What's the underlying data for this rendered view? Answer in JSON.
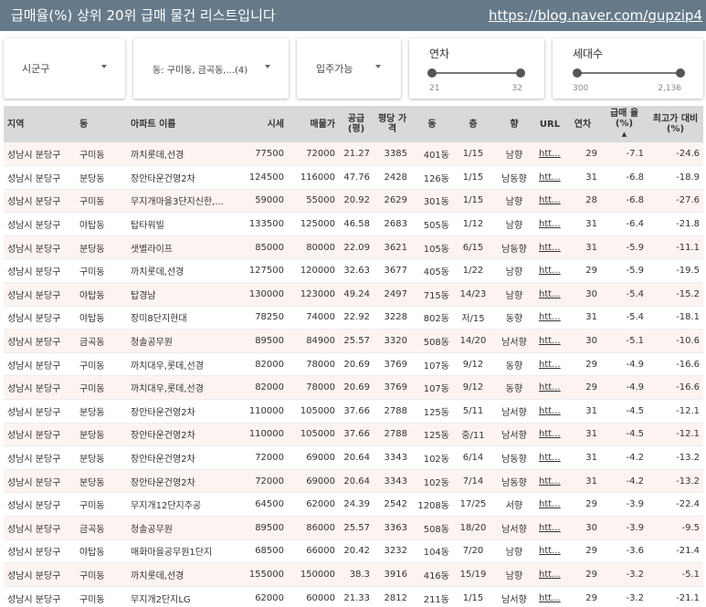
{
  "header": {
    "title": "급매율(%) 상위 20위 급매 물건 리스트입니다",
    "link": "https://blog.naver.com/gupzip4"
  },
  "filters": {
    "sigungu": "시군구",
    "dong": "동: 구미동, 금곡동,...(4)",
    "movein": "입주가능",
    "year_slider": {
      "title": "연차",
      "min": "21",
      "max": "32"
    },
    "households_slider": {
      "title": "세대수",
      "min": "300",
      "max": "2,136"
    }
  },
  "table": {
    "headers": [
      "지역",
      "동",
      "아파트 이름",
      "시세",
      "매물가",
      "공급 (평)",
      "평당 가격",
      "동",
      "층",
      "향",
      "URL",
      "연차",
      "급매 율(%)",
      "최고가 대비(%)"
    ],
    "sort_icon": "▲",
    "rows": [
      [
        "성남시 분당구",
        "구미동",
        "까치롯데,선경",
        "77500",
        "72000",
        "21.27",
        "3385",
        "401동",
        "1/15",
        "남향",
        "htt...",
        "29",
        "-7.1",
        "-24.6"
      ],
      [
        "성남시 분당구",
        "분당동",
        "장안타운건영2차",
        "124500",
        "116000",
        "47.76",
        "2428",
        "126동",
        "1/15",
        "남동향",
        "htt...",
        "31",
        "-6.8",
        "-18.9"
      ],
      [
        "성남시 분당구",
        "구미동",
        "무지개마을3단지신한,...",
        "59000",
        "55000",
        "20.92",
        "2629",
        "301동",
        "1/15",
        "남향",
        "htt...",
        "28",
        "-6.8",
        "-27.6"
      ],
      [
        "성남시 분당구",
        "야탑동",
        "탑타워빌",
        "133500",
        "125000",
        "46.58",
        "2683",
        "505동",
        "1/12",
        "남향",
        "htt...",
        "31",
        "-6.4",
        "-21.8"
      ],
      [
        "성남시 분당구",
        "분당동",
        "샛별라이프",
        "85000",
        "80000",
        "22.09",
        "3621",
        "105동",
        "6/15",
        "남동향",
        "htt...",
        "31",
        "-5.9",
        "-11.1"
      ],
      [
        "성남시 분당구",
        "구미동",
        "까치롯데,선경",
        "127500",
        "120000",
        "32.63",
        "3677",
        "405동",
        "1/22",
        "남향",
        "htt...",
        "29",
        "-5.9",
        "-19.5"
      ],
      [
        "성남시 분당구",
        "야탑동",
        "탑경남",
        "130000",
        "123000",
        "49.24",
        "2497",
        "715동",
        "14/23",
        "남향",
        "htt...",
        "30",
        "-5.4",
        "-15.2"
      ],
      [
        "성남시 분당구",
        "야탑동",
        "장미8단지현대",
        "78250",
        "74000",
        "22.92",
        "3228",
        "802동",
        "저/15",
        "동향",
        "htt...",
        "31",
        "-5.4",
        "-18.1"
      ],
      [
        "성남시 분당구",
        "금곡동",
        "청솔공무원",
        "89500",
        "84900",
        "25.57",
        "3320",
        "508동",
        "14/20",
        "남서향",
        "htt...",
        "30",
        "-5.1",
        "-10.6"
      ],
      [
        "성남시 분당구",
        "구미동",
        "까치대우,롯데,선경",
        "82000",
        "78000",
        "20.69",
        "3769",
        "107동",
        "9/12",
        "동향",
        "htt...",
        "29",
        "-4.9",
        "-16.6"
      ],
      [
        "성남시 분당구",
        "구미동",
        "까치대우,롯데,선경",
        "82000",
        "78000",
        "20.69",
        "3769",
        "107동",
        "9/12",
        "동향",
        "htt...",
        "29",
        "-4.9",
        "-16.6"
      ],
      [
        "성남시 분당구",
        "분당동",
        "장안타운건영2차",
        "110000",
        "105000",
        "37.66",
        "2788",
        "125동",
        "5/11",
        "남서향",
        "htt...",
        "31",
        "-4.5",
        "-12.1"
      ],
      [
        "성남시 분당구",
        "분당동",
        "장안타운건영2차",
        "110000",
        "105000",
        "37.66",
        "2788",
        "125동",
        "중/11",
        "남서향",
        "htt...",
        "31",
        "-4.5",
        "-12.1"
      ],
      [
        "성남시 분당구",
        "분당동",
        "장안타운건영2차",
        "72000",
        "69000",
        "20.64",
        "3343",
        "102동",
        "6/14",
        "남동향",
        "htt...",
        "31",
        "-4.2",
        "-13.2"
      ],
      [
        "성남시 분당구",
        "분당동",
        "장안타운건영2차",
        "72000",
        "69000",
        "20.64",
        "3343",
        "102동",
        "7/14",
        "남동향",
        "htt...",
        "31",
        "-4.2",
        "-13.2"
      ],
      [
        "성남시 분당구",
        "구미동",
        "무지개12단지주공",
        "64500",
        "62000",
        "24.39",
        "2542",
        "1208동",
        "17/25",
        "서향",
        "htt...",
        "29",
        "-3.9",
        "-22.4"
      ],
      [
        "성남시 분당구",
        "금곡동",
        "청솔공무원",
        "89500",
        "86000",
        "25.57",
        "3363",
        "508동",
        "18/20",
        "남서향",
        "htt...",
        "30",
        "-3.9",
        "-9.5"
      ],
      [
        "성남시 분당구",
        "야탑동",
        "매화마을공무원1단지",
        "68500",
        "66000",
        "20.42",
        "3232",
        "104동",
        "7/20",
        "남향",
        "htt...",
        "29",
        "-3.6",
        "-21.4"
      ],
      [
        "성남시 분당구",
        "구미동",
        "까치롯데,선경",
        "155000",
        "150000",
        "38.3",
        "3916",
        "416동",
        "15/19",
        "남향",
        "htt...",
        "29",
        "-3.2",
        "-5.1"
      ],
      [
        "성남시 분당구",
        "구미동",
        "무지개2단지LG",
        "62000",
        "60000",
        "21.33",
        "2812",
        "211동",
        "1/15",
        "남서향",
        "htt...",
        "29",
        "-3.2",
        "-21.1"
      ]
    ]
  }
}
